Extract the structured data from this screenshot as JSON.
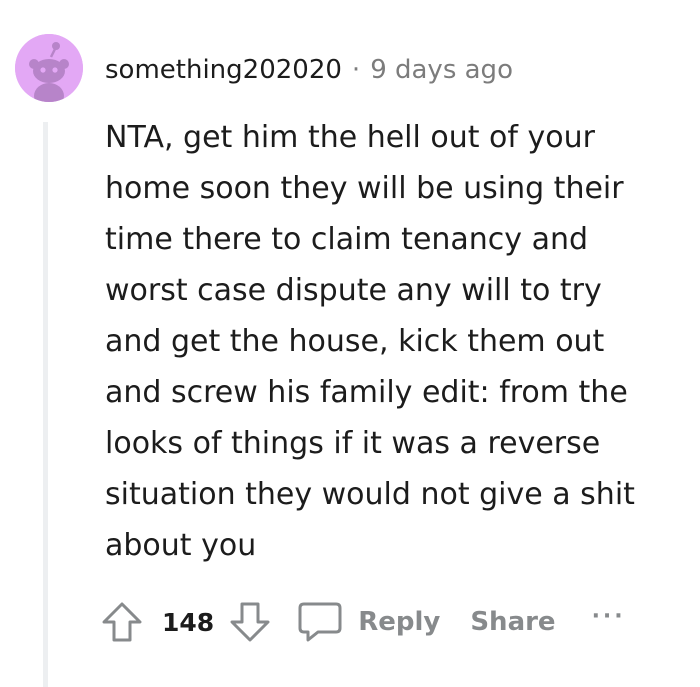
{
  "comment": {
    "username": "something202020",
    "separator": "·",
    "timestamp": "9 days ago",
    "body": "NTA, get him the hell out of your\nhome soon they will be using their\ntime there to claim tenancy and\nworst case dispute any will to try\nand get the house, kick them out\nand screw his family edit: from the\nlooks of things if it was a reverse\nsituation they would not give a shit\nabout you",
    "vote_count": "148",
    "reply_label": "Reply",
    "share_label": "Share",
    "more_label": "···"
  },
  "colors": {
    "avatar_bg": "#e3a8f5",
    "thread_line": "#edeff1",
    "action_gray": "#878a8c",
    "text": "#1c1c1c",
    "muted": "#7c7c7c"
  },
  "icons": {
    "avatar": "snoo-avatar-icon",
    "upvote": "arrow-up-icon",
    "downvote": "arrow-down-icon",
    "reply": "speech-bubble-icon"
  }
}
